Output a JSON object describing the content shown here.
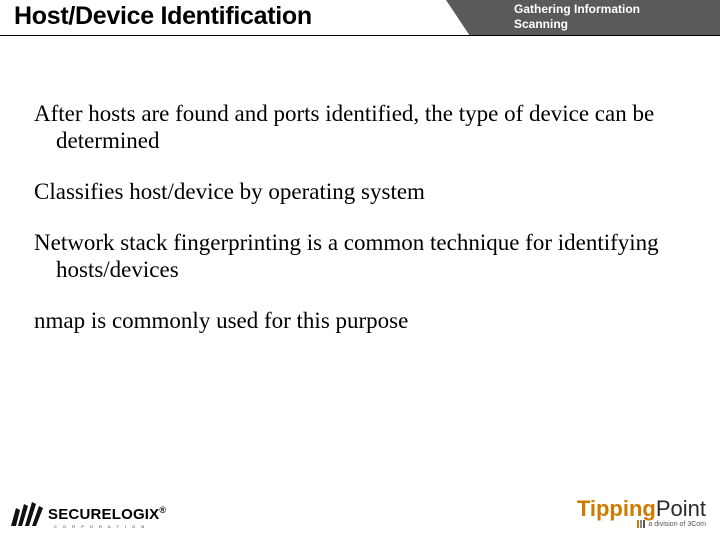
{
  "header": {
    "title": "Host/Device Identification",
    "breadcrumb": {
      "line1": "Gathering Information",
      "line2": "Scanning"
    }
  },
  "body": {
    "paragraphs": [
      "After hosts are found and ports identified, the type of device can be determined",
      "Classifies host/device by operating system",
      "Network stack fingerprinting is a common technique for identifying hosts/devices",
      "nmap is commonly used for this purpose"
    ]
  },
  "footer": {
    "left_logo": {
      "name": "SECURELOGIX",
      "reg": "®",
      "sub": "C  O  R  P  O  R  A  T  I  O  N"
    },
    "right_logo": {
      "part1": "Tipping",
      "part2": "Point",
      "sub": "a division of 3Com"
    }
  }
}
